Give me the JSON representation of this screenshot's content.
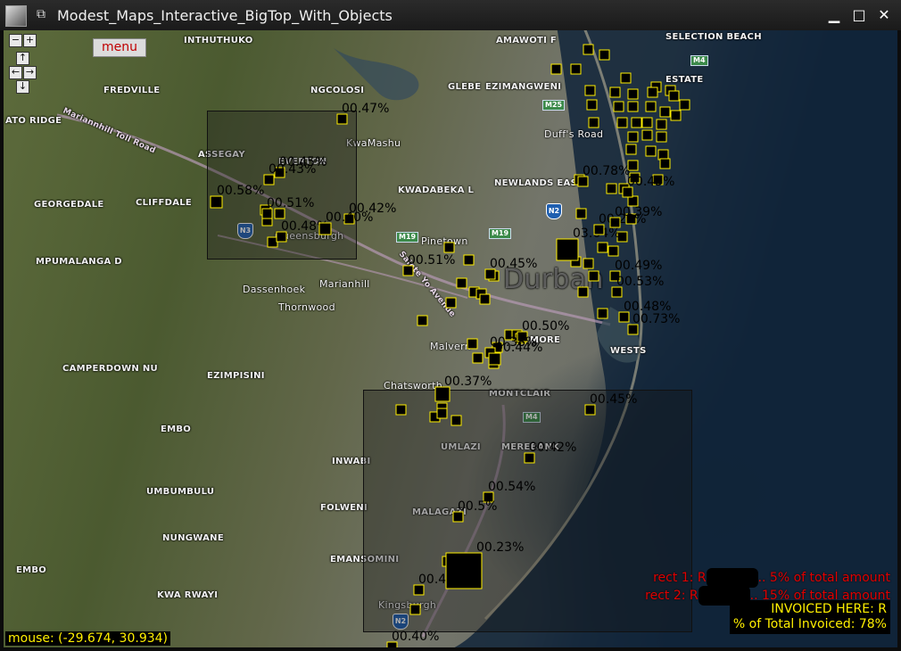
{
  "window": {
    "title": "Modest_Maps_Interactive_BigTop_With_Objects",
    "controls": {
      "minimize": "▁",
      "maximize": "□",
      "close": "✕"
    }
  },
  "map_ui": {
    "menu_label": "menu",
    "zoom_in": "+",
    "zoom_out": "−",
    "pan_up": "↑",
    "pan_left": "←",
    "pan_right": "→",
    "pan_down": "↓",
    "mouse_label": "mouse: (-29.674, 30.934)"
  },
  "place_labels": [
    "INTHUTHUKO",
    "AMAWOTI F",
    "SELECTION BEACH",
    "FREDVILLE",
    "NGCOLOSI",
    "GLEBE",
    "EZIMANGWENI",
    "ESTATE",
    "ATO RIDGE",
    "KwaMashu",
    "Duff's Road",
    "ASSEGAY",
    "EVERTON",
    "KWADABEKA L",
    "NEWLANDS EAST",
    "GEORGEDALE",
    "CLIFFDALE",
    "Queensburgh",
    "Pinetown",
    "MPUMALANGA D",
    "Marianhill",
    "Durban",
    "Dassenhoek",
    "Thornwood",
    "Malvern",
    "MORE",
    "WESTS",
    "CAMPERDOWN NU",
    "EZIMPISINI",
    "Chatsworth",
    "MONTCLAIR",
    "EMBO",
    "UMLAZI",
    "MEREBANK",
    "INWABI",
    "UMBUMBULU",
    "FOLWENI",
    "MALAGAZI",
    "NUNGWANE",
    "EMBO",
    "EMANSOMINI",
    "KWA RWAYI",
    "Kingsburgh",
    "Mariannhill Toll Road",
    "Sainte Yo Avenue"
  ],
  "road_shields": [
    "M4",
    "M25",
    "M19",
    "M19",
    "M4",
    "N2",
    "N3",
    "N2"
  ],
  "markers": [
    {
      "pct": "00.47%"
    },
    {
      "pct": "00.45%"
    },
    {
      "pct": "00.58%"
    },
    {
      "pct": "00.51%"
    },
    {
      "pct": "00.42%"
    },
    {
      "pct": "00.48%"
    },
    {
      "pct": "00.51%"
    },
    {
      "pct": "00.40%"
    },
    {
      "pct": "00.45%"
    },
    {
      "pct": "03.64%"
    },
    {
      "pct": "00.78%"
    },
    {
      "pct": "00.45%"
    },
    {
      "pct": "00.29%"
    },
    {
      "pct": "00.39%"
    },
    {
      "pct": "00.50%"
    },
    {
      "pct": "00.49%"
    },
    {
      "pct": "00.53%"
    },
    {
      "pct": "00.48%"
    },
    {
      "pct": "00.73%"
    },
    {
      "pct": "00.38%"
    },
    {
      "pct": "00.44%"
    },
    {
      "pct": "00.45%"
    },
    {
      "pct": "00.42%"
    },
    {
      "pct": "00.54%"
    },
    {
      "pct": "00.5%"
    },
    {
      "pct": "00.23%"
    },
    {
      "pct": "00.44%"
    },
    {
      "pct": "00.40%"
    },
    {
      "pct": "00.43%"
    },
    {
      "pct": "00.37%"
    }
  ],
  "legend": {
    "rect1_prefix": "rect 1: R",
    "rect1_suffix": ".. 5% of total amount",
    "rect2_prefix": "rect 2: R",
    "rect2_suffix": ".. 15% of total amount",
    "invoiced_here": "INVOICED HERE: R",
    "pct_total": "% of Total Invoiced: 78%"
  },
  "colors": {
    "marker_fill": "#000000",
    "marker_border": "#ffef00",
    "legend_red": "#e00000",
    "legend_yellow": "#ffef00",
    "water": "#0f2236"
  }
}
